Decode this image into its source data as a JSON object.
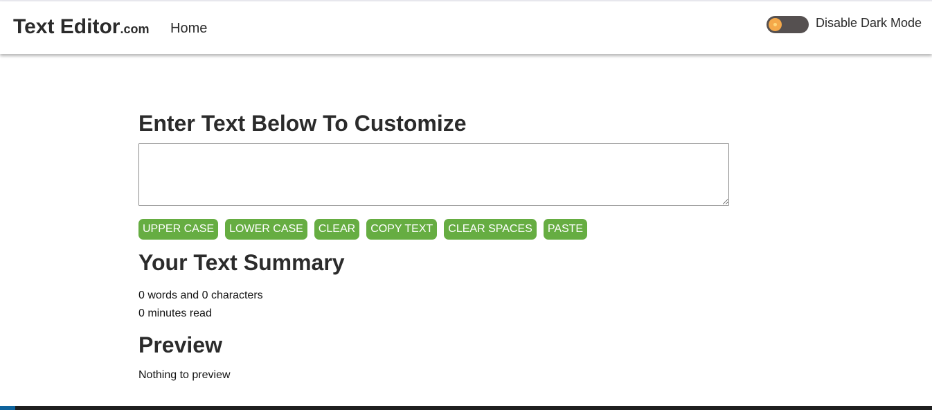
{
  "navbar": {
    "brand_main": "Text Editor",
    "brand_suffix": ".com",
    "home_link": "Home",
    "dark_mode_label": "Disable Dark Mode"
  },
  "editor": {
    "heading": "Enter Text Below To Customize",
    "textarea_value": ""
  },
  "buttons": [
    {
      "label": "UPPER CASE"
    },
    {
      "label": "LOWER CASE"
    },
    {
      "label": "CLEAR"
    },
    {
      "label": "COPY TEXT"
    },
    {
      "label": "CLEAR SPACES"
    },
    {
      "label": "PASTE"
    }
  ],
  "summary": {
    "heading": "Your Text Summary",
    "counts_line": "0 words and 0 characters",
    "read_time_line": "0 minutes read"
  },
  "preview": {
    "heading": "Preview",
    "text": "Nothing to preview"
  },
  "colors": {
    "button_green": "#66ad42",
    "toggle_track": "#555050",
    "toggle_knob": "#f5a94a"
  }
}
